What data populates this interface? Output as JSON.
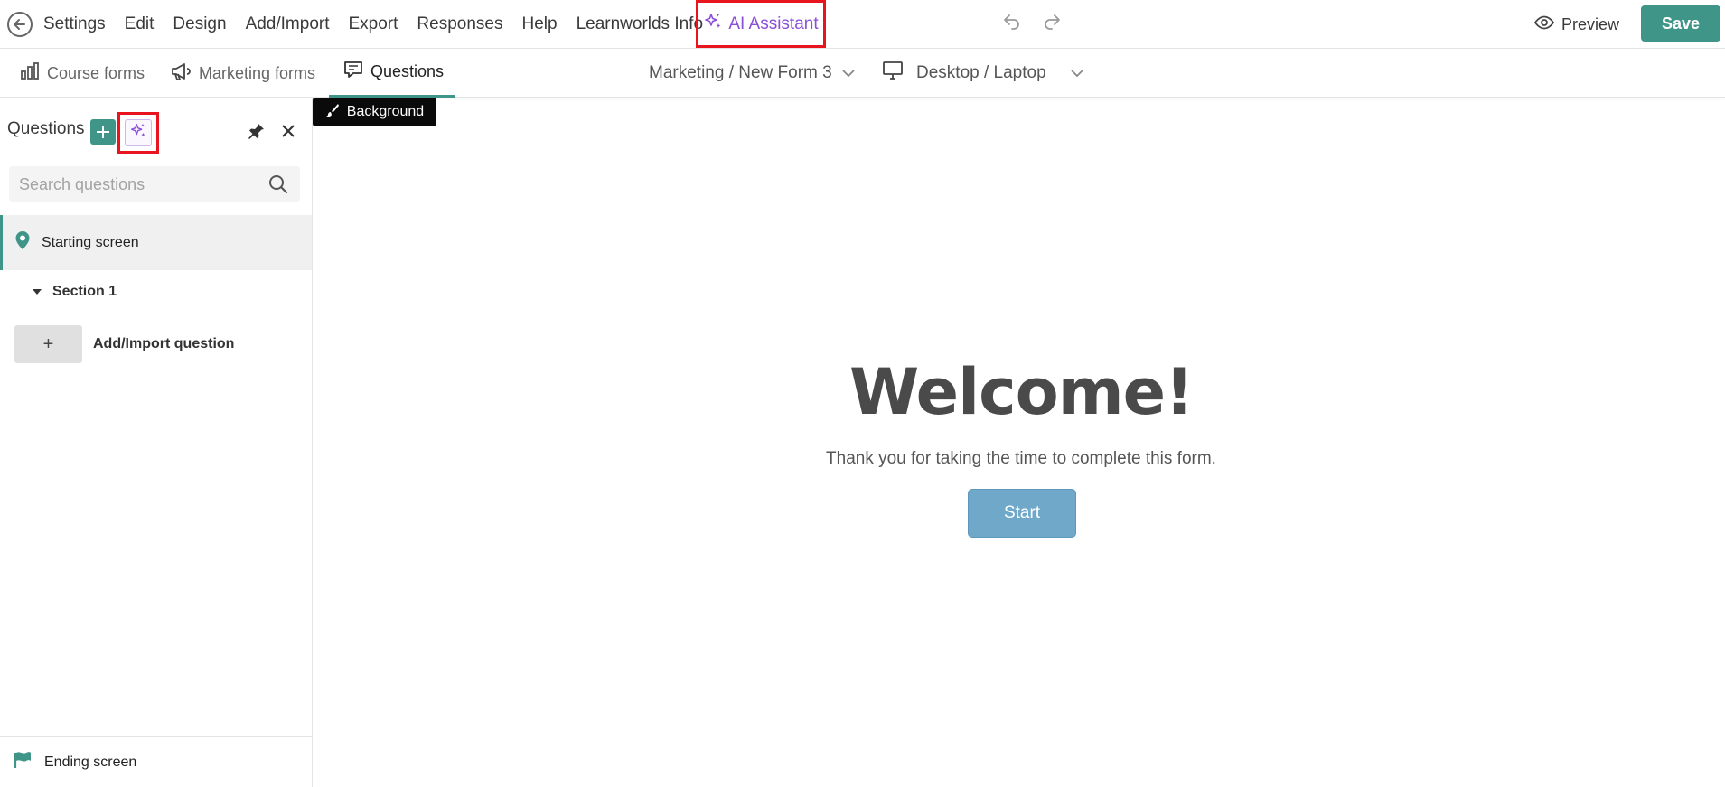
{
  "menu": {
    "items": [
      "Settings",
      "Edit",
      "Design",
      "Add/Import",
      "Export",
      "Responses",
      "Help",
      "Learnworlds Info"
    ],
    "ai_assistant": "AI Assistant",
    "preview": "Preview",
    "save": "Save"
  },
  "subtabs": {
    "course_forms": "Course forms",
    "marketing_forms": "Marketing forms",
    "questions": "Questions",
    "form_path": "Marketing / New Form 3",
    "device": "Desktop / Laptop"
  },
  "sidebar": {
    "title": "Questions",
    "search_placeholder": "Search questions",
    "starting_screen": "Starting screen",
    "section": "Section 1",
    "add_question_symbol": "+",
    "add_question": "Add/Import question",
    "ending_screen": "Ending screen"
  },
  "canvas": {
    "background_button": "Background",
    "welcome_title": "Welcome!",
    "thanks_text": "Thank you for taking the time to complete this form.",
    "start_button": "Start"
  },
  "colors": {
    "accent": "#3f9587",
    "ai_purple": "#8a4fd8",
    "highlight_red": "#e8141e",
    "start_button": "#6fa8c9"
  },
  "icons": [
    "back-arrow-icon",
    "sparkle-icon",
    "undo-icon",
    "redo-icon",
    "eye-icon",
    "bar-chart-icon",
    "megaphone-icon",
    "questions-icon",
    "chevron-down-icon",
    "monitor-icon",
    "plus-icon",
    "pin-icon",
    "close-icon",
    "search-icon",
    "location-pin-icon",
    "caret-down-icon",
    "flag-icon",
    "brush-icon"
  ]
}
